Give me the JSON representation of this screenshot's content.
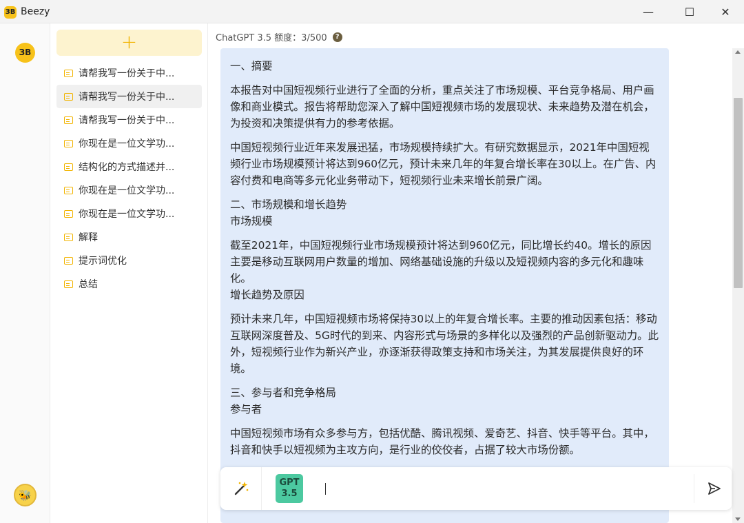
{
  "window": {
    "title": "Beezy",
    "logo_text": "ЗB",
    "controls": {
      "minimize": "—",
      "maximize": "☐",
      "close": "✕"
    }
  },
  "rail": {
    "logo_text": "ЗB",
    "bee_glyph": "🐝"
  },
  "sidebar": {
    "new_chat_label": "+",
    "items": [
      {
        "label": "请帮我写一份关于中..."
      },
      {
        "label": "请帮我写一份关于中..."
      },
      {
        "label": "请帮我写一份关于中..."
      },
      {
        "label": "你现在是一位文学功..."
      },
      {
        "label": "结构化的方式描述并..."
      },
      {
        "label": "你现在是一位文学功..."
      },
      {
        "label": "你现在是一位文学功..."
      },
      {
        "label": "解释"
      },
      {
        "label": "提示词优化"
      },
      {
        "label": "总结"
      }
    ]
  },
  "header": {
    "quota_text": "ChatGPT 3.5 额度：3/500",
    "help_glyph": "?"
  },
  "message": {
    "paragraphs": [
      "一、摘要",
      "本报告对中国短视频行业进行了全面的分析，重点关注了市场规模、平台竞争格局、用户画像和商业模式。报告将帮助您深入了解中国短视频市场的发展现状、未来趋势及潜在机会，为投资和决策提供有力的参考依据。",
      "中国短视频行业近年来发展迅猛，市场规模持续扩大。有研究数据显示，2021年中国短视频行业市场规模预计将达到960亿元，预计未来几年的年复合增长率在30以上。在广告、内容付费和电商等多元化业务带动下，短视频行业未来增长前景广阔。",
      "二、市场规模和增长趋势\n市场规模",
      "截至2021年，中国短视频行业市场规模预计将达到960亿元，同比增长约40。增长的原因主要是移动互联网用户数量的增加、网络基础设施的升级以及短视频内容的多元化和趣味化。\n增长趋势及原因",
      "预计未来几年，中国短视频市场将保持30以上的年复合增长率。主要的推动因素包括：移动互联网深度普及、5G时代的到来、内容形式与场景的多样化以及强烈的产品创新驱动力。此外，短视频行业作为新兴产业，亦逐渐获得政策支持和市场关注，为其发展提供良好的环境。",
      "三、参与者和竞争格局\n参与者",
      "中国短视频市场有众多参与方，包括优酷、腾讯视频、爱奇艺、抖音、快手等平台。其中，抖音和快手以短视频为主攻方向，是行业的佼佼者，占据了较大市场份额。"
    ]
  },
  "input": {
    "model_badge_line1": "GPT",
    "model_badge_line2": "3.5",
    "value": "",
    "placeholder": ""
  }
}
